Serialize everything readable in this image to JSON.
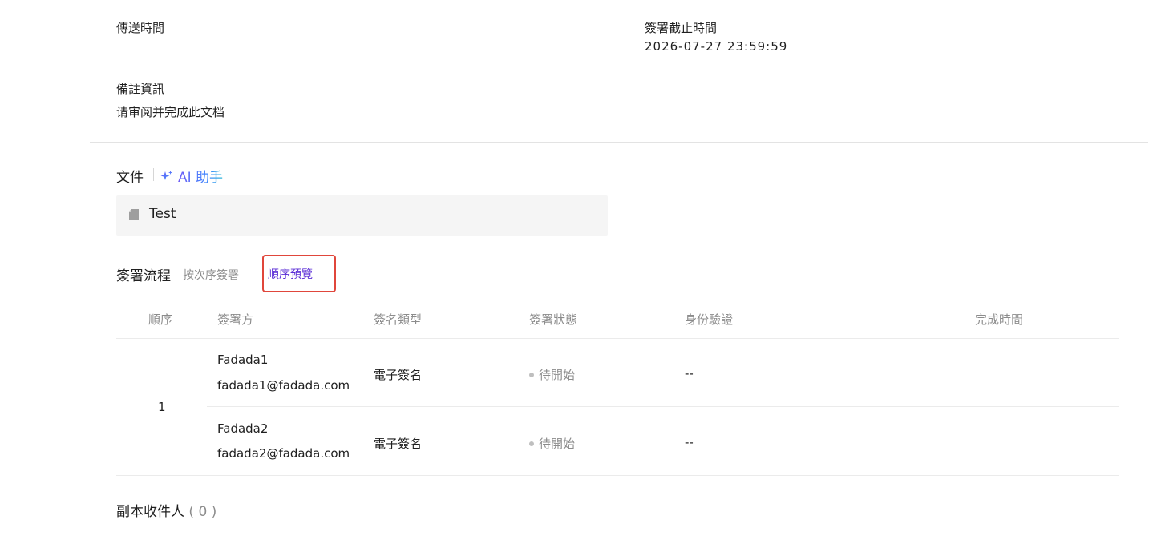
{
  "info": {
    "send_time_label": "傳送時間",
    "deadline_label": "簽署截止時間",
    "deadline_value": "2026-07-27 23:59:59",
    "remark_label": "備註資訊",
    "remark_value": "请审阅并完成此文档"
  },
  "files": {
    "title": "文件",
    "ai_label": "AI 助手",
    "file_name": "Test"
  },
  "flow": {
    "title": "簽署流程",
    "mode": "按次序簽署",
    "preview_link": "順序預覽",
    "columns": [
      "順序",
      "簽署方",
      "簽名類型",
      "簽署狀態",
      "身份驗證",
      "完成時間"
    ],
    "order": "1",
    "signers": [
      {
        "name": "Fadada1",
        "email": "fadada1@fadada.com",
        "sign_type": "電子簽名",
        "status": "待開始",
        "verify": "--",
        "done_time": ""
      },
      {
        "name": "Fadada2",
        "email": "fadada2@fadada.com",
        "sign_type": "電子簽名",
        "status": "待開始",
        "verify": "--",
        "done_time": ""
      }
    ]
  },
  "cc": {
    "title": "副本收件人",
    "count": "( 0 )"
  },
  "colors": {
    "accent": "#5b2ed6",
    "highlight": "#e0463b",
    "muted": "#8c8c8c"
  }
}
